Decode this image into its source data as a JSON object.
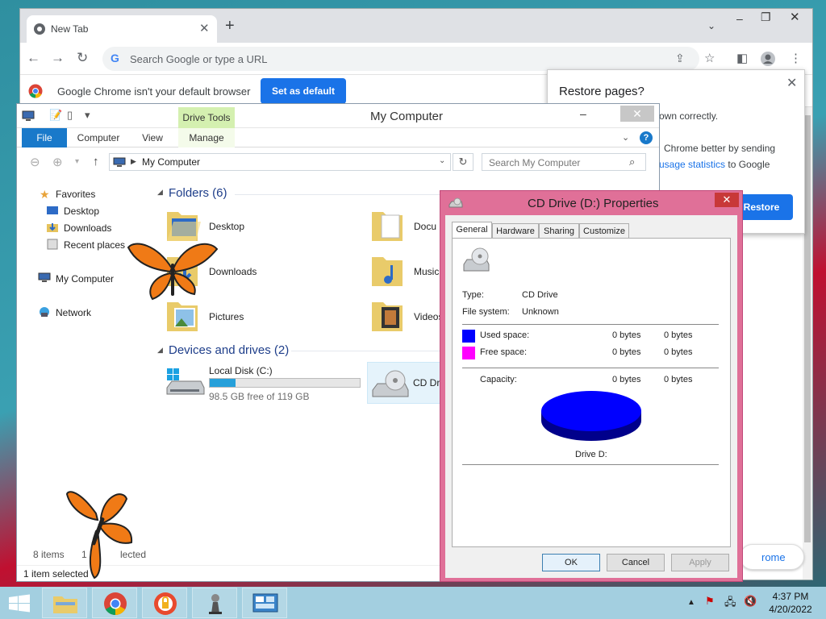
{
  "chrome": {
    "tab_title": "New Tab",
    "omnibox_placeholder": "Search Google or type a URL",
    "infobar_text": "Google Chrome isn't your default browser",
    "set_default_label": "Set as default",
    "restore": {
      "title": "Restore pages?",
      "line1": "own correctly.",
      "line2": "Chrome better by sending",
      "line3_link": "usage statistics",
      "line3_rest": " to Google",
      "button": "Restore"
    },
    "customize_pill": "rome"
  },
  "explorer": {
    "title": "My Computer",
    "contextual_tab": "Drive Tools",
    "ribbon_tabs": [
      "File",
      "Computer",
      "View",
      "Manage"
    ],
    "address": "My Computer",
    "search_placeholder": "Search My Computer",
    "nav": {
      "favorites": "Favorites",
      "desktop": "Desktop",
      "downloads": "Downloads",
      "recent": "Recent places",
      "my_computer": "My Computer",
      "network": "Network"
    },
    "folders_header": "Folders (6)",
    "folders": [
      "Desktop",
      "Docu",
      "Downloads",
      "Music",
      "Pictures",
      "Videos"
    ],
    "devices_header": "Devices and drives (2)",
    "local_disk": {
      "name": "Local Disk (C:)",
      "free_text": "98.5 GB free of 119 GB",
      "used_fraction": 0.17
    },
    "cd_drive": {
      "name": "CD Dri"
    },
    "status_items": "8 items",
    "status_selected_count": "1 it",
    "status_selected_tail": "lected",
    "status_bar": "1 item selected"
  },
  "props": {
    "title": "CD Drive (D:) Properties",
    "tabs": [
      "General",
      "Hardware",
      "Sharing",
      "Customize"
    ],
    "type_label": "Type:",
    "type_value": "CD Drive",
    "fs_label": "File system:",
    "fs_value": "Unknown",
    "used_label": "Used space:",
    "used_bytes": "0 bytes",
    "used_bytes2": "0 bytes",
    "free_label": "Free space:",
    "free_bytes": "0 bytes",
    "free_bytes2": "0 bytes",
    "capacity_label": "Capacity:",
    "capacity_bytes": "0 bytes",
    "capacity_bytes2": "0 bytes",
    "drive_caption": "Drive D:",
    "ok": "OK",
    "cancel": "Cancel",
    "apply": "Apply",
    "used_color": "#0000ff",
    "free_color": "#ff00ff"
  },
  "taskbar": {
    "time": "4:37 PM",
    "date": "4/20/2022"
  }
}
